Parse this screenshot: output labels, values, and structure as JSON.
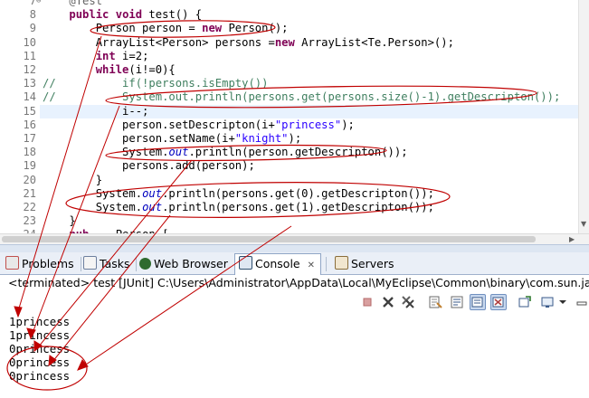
{
  "editor": {
    "lines": [
      {
        "num": "7",
        "fold": "⊖",
        "parts": [
          {
            "t": "    "
          },
          {
            "t": "@Test",
            "c": "an"
          }
        ]
      },
      {
        "num": "8",
        "parts": [
          {
            "t": "    "
          },
          {
            "t": "public",
            "c": "kw"
          },
          {
            "t": " "
          },
          {
            "t": "void",
            "c": "kw"
          },
          {
            "t": " test() {"
          }
        ]
      },
      {
        "num": "9",
        "parts": [
          {
            "t": "        Person person = "
          },
          {
            "t": "new",
            "c": "kw"
          },
          {
            "t": " Person();"
          }
        ]
      },
      {
        "num": "10",
        "parts": [
          {
            "t": "        ArrayList<Person> persons ="
          },
          {
            "t": "new",
            "c": "kw"
          },
          {
            "t": " ArrayList<Te.Person>();"
          }
        ]
      },
      {
        "num": "11",
        "parts": [
          {
            "t": "        "
          },
          {
            "t": "int",
            "c": "kw"
          },
          {
            "t": " i=2;"
          }
        ]
      },
      {
        "num": "12",
        "parts": [
          {
            "t": "        "
          },
          {
            "t": "while",
            "c": "kw"
          },
          {
            "t": "(i!=0){"
          }
        ]
      },
      {
        "num": "13",
        "parts": [
          {
            "t": "//          if(!persons.isEmpty())",
            "c": "cm"
          }
        ]
      },
      {
        "num": "14",
        "parts": [
          {
            "t": "//          System.out.println(persons.get(persons.size()-1).getDescripton());",
            "c": "cm"
          }
        ]
      },
      {
        "num": "15",
        "parts": [
          {
            "t": "            i--;"
          }
        ]
      },
      {
        "num": "16",
        "parts": [
          {
            "t": "            person.setDescripton(i+"
          },
          {
            "t": "\"princess\"",
            "c": "st"
          },
          {
            "t": ");"
          }
        ]
      },
      {
        "num": "17",
        "parts": [
          {
            "t": "            person.setName(i+"
          },
          {
            "t": "\"knight\"",
            "c": "st"
          },
          {
            "t": ");"
          }
        ]
      },
      {
        "num": "18",
        "parts": [
          {
            "t": "            System."
          },
          {
            "t": "out",
            "c": "fi"
          },
          {
            "t": ".println(person.getDescripton());"
          }
        ]
      },
      {
        "num": "19",
        "parts": [
          {
            "t": "            persons.add(person);"
          }
        ]
      },
      {
        "num": "20",
        "parts": [
          {
            "t": "        }"
          }
        ]
      },
      {
        "num": "21",
        "parts": [
          {
            "t": "        System."
          },
          {
            "t": "out",
            "c": "fi"
          },
          {
            "t": ".println(persons.get(0).getDescripton());"
          }
        ]
      },
      {
        "num": "22",
        "parts": [
          {
            "t": "        System."
          },
          {
            "t": "out",
            "c": "fi"
          },
          {
            "t": ".println(persons.get(1).getDescripton());"
          }
        ]
      },
      {
        "num": "23",
        "parts": [
          {
            "t": "    }"
          }
        ]
      },
      {
        "num": "24",
        "parts": [
          {
            "t": "    "
          },
          {
            "t": "pub",
            "c": "kw"
          },
          {
            "t": "    Person ["
          }
        ]
      }
    ],
    "current_line": "15"
  },
  "tabs": [
    {
      "id": "problems",
      "label": "Problems",
      "icon_color": "#c0504d"
    },
    {
      "id": "tasks",
      "label": "Tasks",
      "icon_color": "#6d7f9e"
    },
    {
      "id": "web-browser",
      "label": "Web Browser",
      "icon_color": "#3a7a3a"
    },
    {
      "id": "console",
      "label": "Console",
      "icon_color": "#2f4f6f",
      "close": "✕"
    },
    {
      "id": "servers",
      "label": "Servers",
      "icon_color": "#8a6d3b"
    }
  ],
  "console": {
    "status": "<terminated> test [JUnit] C:\\Users\\Administrator\\AppData\\Local\\MyEclipse\\Common\\binary\\com.sun.java.jdk.w",
    "output": [
      "1princess",
      "1princess",
      "0princess",
      "0princess",
      "0princess"
    ]
  },
  "colors": {
    "keyword": "#7f0055",
    "string": "#2a00ff",
    "comment": "#3f7f5f",
    "annotation_ink": "#c00000",
    "current_line": "#e8f2fe"
  }
}
